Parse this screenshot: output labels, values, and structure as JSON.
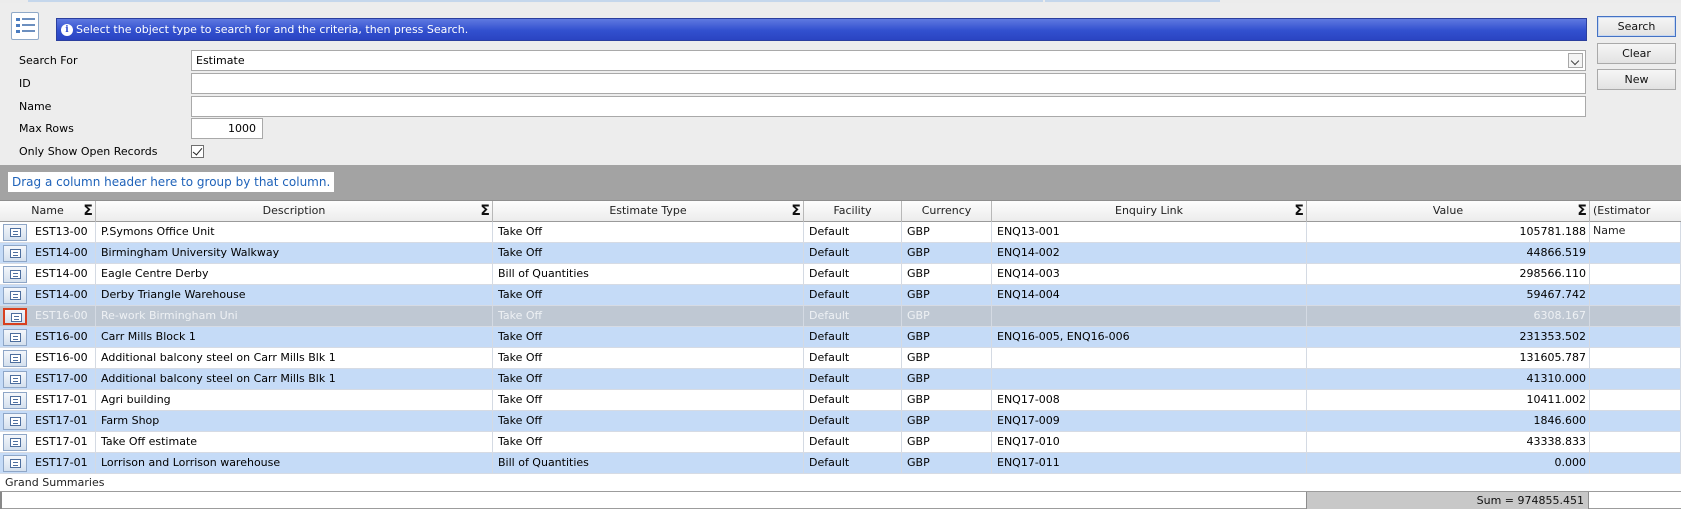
{
  "info_message": "Select the object type to search for and the criteria, then press Search.",
  "buttons": {
    "search": "Search",
    "clear": "Clear",
    "new": "New"
  },
  "form": {
    "search_for_label": "Search For",
    "search_for_value": "Estimate",
    "id_label": "ID",
    "id_value": "",
    "name_label": "Name",
    "name_value": "",
    "max_rows_label": "Max Rows",
    "max_rows_value": "1000",
    "open_records_label": "Only Show Open Records",
    "open_records_checked": true
  },
  "group_hint": "Drag a column header here to group by that column.",
  "columns": {
    "name": "Name",
    "description": "Description",
    "estimate_type": "Estimate Type",
    "facility": "Facility",
    "currency": "Currency",
    "enquiry_link": "Enquiry Link",
    "value": "Value",
    "estimator": "(Estimator Name"
  },
  "rows": [
    {
      "name": "EST13-00",
      "description": "P.Symons Office Unit",
      "type": "Take Off",
      "facility": "Default",
      "currency": "GBP",
      "enquiry": "ENQ13-001",
      "value": "105781.188"
    },
    {
      "name": "EST14-00",
      "description": "Birmingham University Walkway",
      "type": "Take Off",
      "facility": "Default",
      "currency": "GBP",
      "enquiry": "ENQ14-002",
      "value": "44866.519"
    },
    {
      "name": "EST14-00",
      "description": "Eagle Centre Derby",
      "type": "Bill of Quantities",
      "facility": "Default",
      "currency": "GBP",
      "enquiry": "ENQ14-003",
      "value": "298566.110"
    },
    {
      "name": "EST14-00",
      "description": "Derby Triangle Warehouse",
      "type": "Take Off",
      "facility": "Default",
      "currency": "GBP",
      "enquiry": "ENQ14-004",
      "value": "59467.742"
    },
    {
      "name": "EST16-00",
      "description": "Re-work Birmingham Uni",
      "type": "Take Off",
      "facility": "Default",
      "currency": "GBP",
      "enquiry": "",
      "value": "6308.167"
    },
    {
      "name": "EST16-00",
      "description": "Carr Mills Block 1",
      "type": "Take Off",
      "facility": "Default",
      "currency": "GBP",
      "enquiry": "ENQ16-005, ENQ16-006",
      "value": "231353.502"
    },
    {
      "name": "EST16-00",
      "description": "Additional balcony steel on Carr Mills Blk 1",
      "type": "Take Off",
      "facility": "Default",
      "currency": "GBP",
      "enquiry": "",
      "value": "131605.787"
    },
    {
      "name": "EST17-00",
      "description": "Additional balcony steel on Carr Mills Blk 1",
      "type": "Take Off",
      "facility": "Default",
      "currency": "GBP",
      "enquiry": "",
      "value": "41310.000"
    },
    {
      "name": "EST17-01",
      "description": "Agri building",
      "type": "Take Off",
      "facility": "Default",
      "currency": "GBP",
      "enquiry": "ENQ17-008",
      "value": "10411.002"
    },
    {
      "name": "EST17-01",
      "description": "Farm Shop",
      "type": "Take Off",
      "facility": "Default",
      "currency": "GBP",
      "enquiry": "ENQ17-009",
      "value": "1846.600"
    },
    {
      "name": "EST17-01",
      "description": "Take Off estimate",
      "type": "Take Off",
      "facility": "Default",
      "currency": "GBP",
      "enquiry": "ENQ17-010",
      "value": "43338.833"
    },
    {
      "name": "EST17-01",
      "description": "Lorrison and Lorrison warehouse",
      "type": "Bill of Quantities",
      "facility": "Default",
      "currency": "GBP",
      "enquiry": "ENQ17-011",
      "value": "0.000"
    }
  ],
  "grand_summaries_label": "Grand Summaries",
  "value_sum": "Sum = 974855.451"
}
